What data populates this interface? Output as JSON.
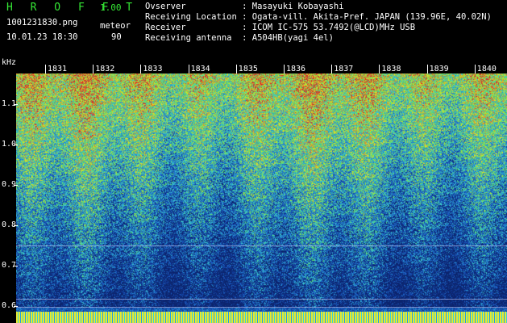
{
  "header": {
    "app_title": "H R O F F T",
    "version": "1.00",
    "filename": "1001231830.png",
    "datetime": "10.01.23 18:30",
    "event_type": "meteor",
    "event_count": "90",
    "info": [
      {
        "label": "Ovserver          ",
        "value": ": Masayuki Kobayashi"
      },
      {
        "label": "Receiving Location",
        "value": ": Ogata-vill. Akita-Pref. JAPAN (139.96E, 40.02N)"
      },
      {
        "label": "Receiver          ",
        "value": ": ICOM IC-575 53.7492(@LCD)MHz USB"
      },
      {
        "label": "Receiving antenna ",
        "value": ": A504HB(yagi 4el)"
      }
    ]
  },
  "axis": {
    "unit": "kHz",
    "y_labels": [
      "1.1",
      "1.0",
      "0.9",
      "0.8",
      "0.7",
      "0.6"
    ],
    "time_labels": [
      "1831",
      "1832",
      "1833",
      "1834",
      "1835",
      "1836",
      "1837",
      "1838",
      "1839",
      "1840"
    ]
  },
  "colors": {
    "title_green": "#35e835",
    "background": "#000000"
  }
}
